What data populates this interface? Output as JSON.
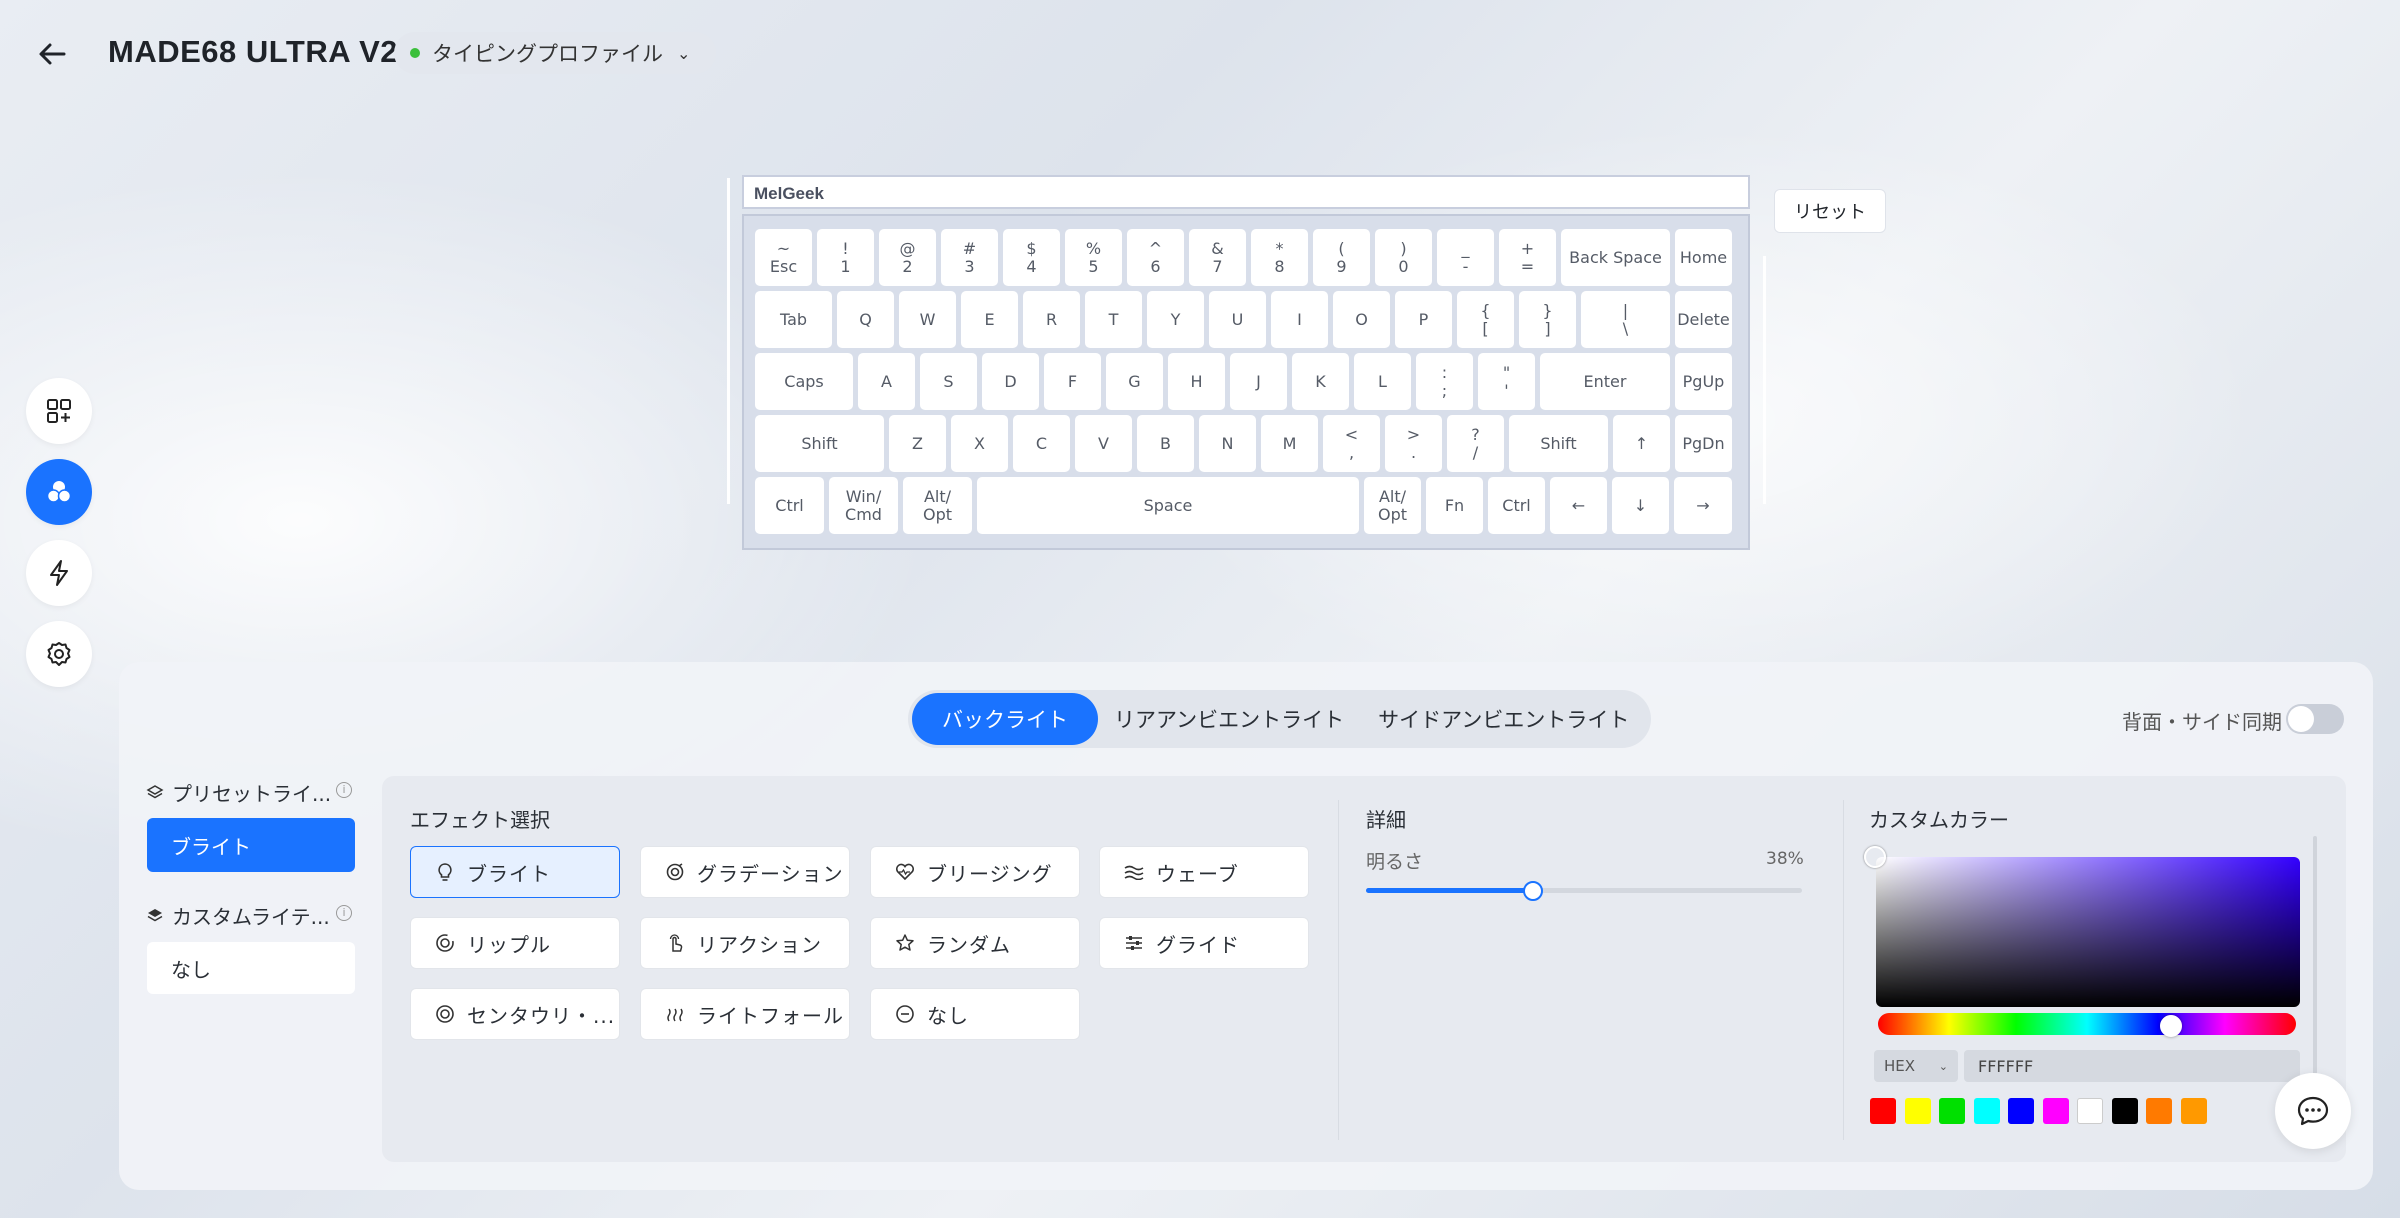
{
  "header": {
    "device_name": "MADE68 ULTRA V2",
    "profile": "タイピングプロファイル",
    "profile_status_color": "#3bbf3b"
  },
  "keyboard": {
    "brand": "MelGeek",
    "reset_label": "リセット",
    "keys": {
      "esc_top": "~",
      "esc": "Esc",
      "k1_top": "!",
      "k1": "1",
      "k2_top": "@",
      "k2": "2",
      "k3_top": "#",
      "k3": "3",
      "k4_top": "$",
      "k4": "4",
      "k5_top": "%",
      "k5": "5",
      "k6_top": "^",
      "k6": "6",
      "k7_top": "&",
      "k7": "7",
      "k8_top": "*",
      "k8": "8",
      "k9_top": "(",
      "k9": "9",
      "k0_top": ")",
      "k0": "0",
      "minus_top": "_",
      "minus": "-",
      "equal_top": "+",
      "equal": "=",
      "backspace": "Back Space",
      "home": "Home",
      "tab": "Tab",
      "q": "Q",
      "w": "W",
      "e": "E",
      "r": "R",
      "t": "T",
      "y": "Y",
      "u": "U",
      "i": "I",
      "o": "O",
      "p": "P",
      "lbr_top": "{",
      "lbr": "[",
      "rbr_top": "}",
      "rbr": "]",
      "bsl_top": "|",
      "bsl": "\\",
      "delete": "Delete",
      "caps": "Caps",
      "a": "A",
      "s": "S",
      "d": "D",
      "f": "F",
      "g": "G",
      "h": "H",
      "j": "J",
      "k": "K",
      "l": "L",
      "semi_top": ":",
      "semi": ";",
      "quote_top": "\"",
      "quote": "'",
      "enter": "Enter",
      "pgup": "PgUp",
      "lshift": "Shift",
      "z": "Z",
      "x": "X",
      "c": "C",
      "v": "V",
      "b": "B",
      "n": "N",
      "m": "M",
      "comma_top": "<",
      "comma": ",",
      "period_top": ">",
      "period": ".",
      "slash_top": "?",
      "slash": "/",
      "rshift": "Shift",
      "up": "↑",
      "pgdn": "PgDn",
      "lctrl": "Ctrl",
      "win_a": "Win/",
      "win_b": "Cmd",
      "lalt_a": "Alt/",
      "lalt_b": "Opt",
      "space": "Space",
      "ralt_a": "Alt/",
      "ralt_b": "Opt",
      "fn": "Fn",
      "rctrl": "Ctrl",
      "left": "←",
      "down": "↓",
      "right": "→"
    }
  },
  "tabs": [
    "バックライト",
    "リアアンビエントライト",
    "サイドアンビエントライト"
  ],
  "sync_label": "背面・サイド同期",
  "sidebar": {
    "preset_heading": "プリセットライ...",
    "preset_item": "ブライト",
    "custom_heading": "カスタムライテ...",
    "custom_item": "なし"
  },
  "effects": {
    "heading": "エフェクト選択",
    "items": [
      "ブライト",
      "グラデーション",
      "ブリージング",
      "ウェーブ",
      "リップル",
      "リアクション",
      "ランダム",
      "グライド",
      "センタウリ・...",
      "ライトフォール",
      "なし"
    ]
  },
  "details": {
    "heading": "詳細",
    "brightness_label": "明るさ",
    "brightness_value": "38%",
    "brightness": 0.38
  },
  "custom_color": {
    "heading": "カスタムカラー",
    "format": "HEX",
    "hex_value": "FFFFFF",
    "swatches": [
      "#ff0000",
      "#ffff00",
      "#00e000",
      "#00ffff",
      "#0000ff",
      "#ff00ff",
      "#ffffff",
      "#000000",
      "#ff7a00",
      "#ff9900"
    ]
  },
  "colors": {
    "accent": "#1a73ff"
  }
}
